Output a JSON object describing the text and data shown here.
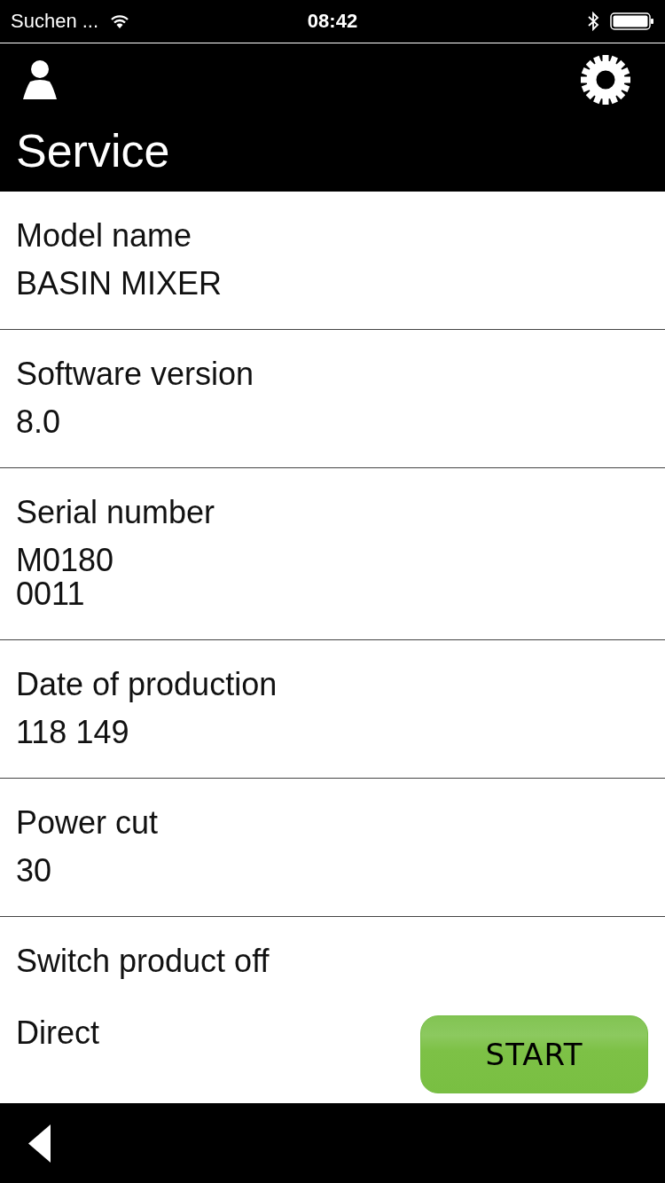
{
  "status_bar": {
    "carrier": "Suchen ...",
    "time": "08:42"
  },
  "header": {
    "title": "Service"
  },
  "info_rows": [
    {
      "label": "Model name",
      "value": "BASIN MIXER"
    },
    {
      "label": "Software version",
      "value": "8.0"
    },
    {
      "label": "Serial number",
      "value": "M0180\n0011"
    },
    {
      "label": "Date of production",
      "value": "118 149"
    },
    {
      "label": "Power cut",
      "value": "30"
    }
  ],
  "switch_off": {
    "label": "Switch product off",
    "option": "Direct",
    "button": "START"
  }
}
